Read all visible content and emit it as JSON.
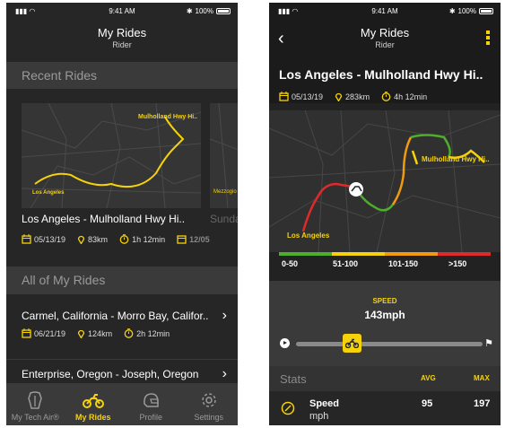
{
  "status": {
    "time": "9:41 AM",
    "battery": "100%"
  },
  "screen1": {
    "title": "My Rides",
    "subtitle": "Rider",
    "recent_header": "Recent Rides",
    "card": {
      "map_label_dest": "Mulholland Hwy Hi..",
      "map_label_origin": "Los Angeles",
      "map_label_next": "Mezzogio",
      "title": "Los Angeles - Mulholland Hwy Hi..",
      "next_title": "Sunday",
      "date": "05/13/19",
      "distance": "83km",
      "duration": "1h 12min",
      "next_date": "12/05"
    },
    "all_header": "All of My Rides",
    "rides": [
      {
        "title": "Carmel, California - Morro Bay, Califor..",
        "date": "06/21/19",
        "distance": "124km",
        "duration": "2h 12min"
      },
      {
        "title": "Enterprise, Oregon - Joseph, Oregon"
      }
    ],
    "tabs": [
      {
        "label": "My Tech Air®",
        "icon": "vest-icon"
      },
      {
        "label": "My Rides",
        "icon": "motorcycle-icon"
      },
      {
        "label": "Profile",
        "icon": "helmet-icon"
      },
      {
        "label": "Settings",
        "icon": "gear-icon"
      }
    ]
  },
  "screen2": {
    "title": "My Rides",
    "subtitle": "Rider",
    "ride_title": "Los Angeles - Mulholland Hwy Hi..",
    "date": "05/13/19",
    "distance": "283km",
    "duration": "4h 12min",
    "map_label_dest": "Mulholland Hwy Hi..",
    "map_label_origin": "Los Angeles",
    "legend": [
      "0-50",
      "51-100",
      "101-150",
      ">150"
    ],
    "legend_colors": [
      "#4caf2a",
      "#f5d20a",
      "#f09a10",
      "#e02a2a"
    ],
    "speed_label": "SPEED",
    "speed_value": "143mph",
    "playback_progress": 0.3,
    "stats": {
      "header": "Stats",
      "avg_label": "AVG",
      "max_label": "MAX",
      "row_label": "Speed",
      "row_unit": "mph",
      "avg": "95",
      "max": "197"
    }
  },
  "colors": {
    "accent": "#f5d20a"
  }
}
